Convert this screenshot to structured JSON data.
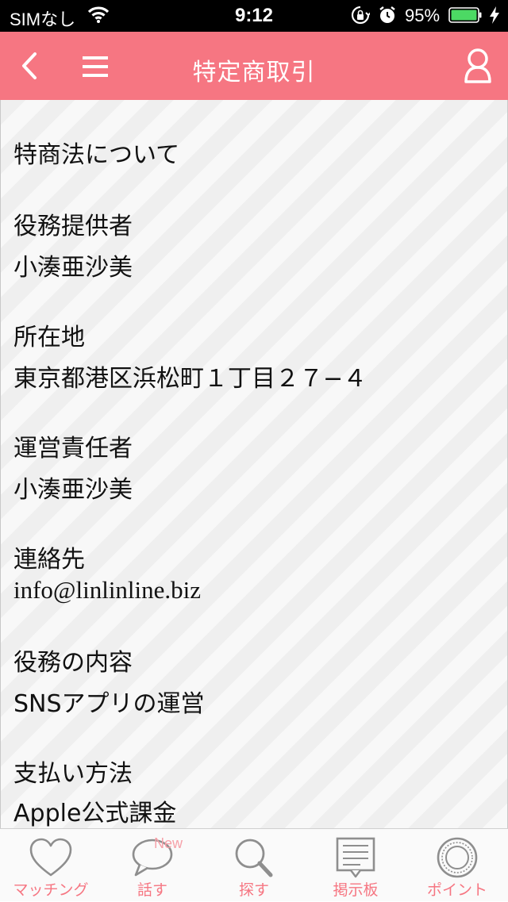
{
  "status_bar": {
    "carrier": "SIMなし",
    "time": "9:12",
    "battery_percent": "95%"
  },
  "header": {
    "title": "特定商取引"
  },
  "content": {
    "lines": [
      "特商法について",
      "役務提供者",
      "小湊亜沙美",
      "所在地",
      "東京都港区浜松町１丁目２７−４",
      "運営責任者",
      "小湊亜沙美",
      "連絡先",
      "info@linlinline.biz",
      "役務の内容",
      "SNSアプリの運営",
      "支払い方法",
      "Apple公式課金"
    ]
  },
  "tabbar": {
    "tabs": [
      {
        "label": "マッチング",
        "icon": "heart-icon"
      },
      {
        "label": "話す",
        "icon": "speech-bubble-icon",
        "badge": "New"
      },
      {
        "label": "探す",
        "icon": "search-icon"
      },
      {
        "label": "掲示板",
        "icon": "board-icon"
      },
      {
        "label": "ポイント",
        "icon": "coin-icon"
      }
    ]
  },
  "colors": {
    "accent": "#f67682",
    "tab_label": "#f67682",
    "text": "#111111"
  }
}
